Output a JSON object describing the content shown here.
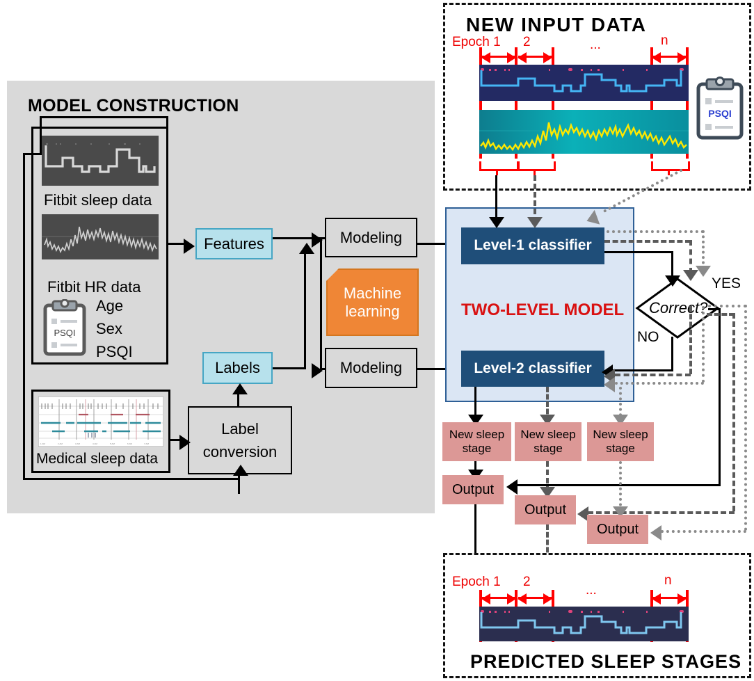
{
  "model_construction": {
    "title": "MODEL CONSTRUCTION",
    "sources": {
      "fitbit_sleep_label": "Fitbit sleep data",
      "fitbit_hr_label": "Fitbit HR data",
      "demographics": [
        "Age",
        "Sex",
        "PSQI"
      ],
      "clipboard_text": "PSQI",
      "medical_label": "Medical sleep data"
    },
    "features_label": "Features",
    "labels_label": "Labels",
    "label_conversion": "Label\nconversion",
    "label_conversion_line1": "Label",
    "label_conversion_line2": "conversion",
    "modeling_top": "Modeling",
    "modeling_bottom": "Modeling",
    "machine_learning_line1": "Machine",
    "machine_learning_line2": "learning"
  },
  "new_input": {
    "title": "NEW  INPUT  DATA",
    "epoch_first": "Epoch 1",
    "epoch_second": "2",
    "epoch_ellipsis": "...",
    "epoch_last": "n",
    "clipboard_text": "PSQI"
  },
  "two_level_model": {
    "title": "TWO-LEVEL MODEL",
    "level1": "Level-1  classifier",
    "level2": "Level-2 classifier",
    "decision": "Correct?",
    "yes": "YES",
    "no": "NO"
  },
  "outputs": {
    "new_sleep_stage": "New sleep\nstage",
    "new_sleep_stage_line1": "New sleep",
    "new_sleep_stage_line2": "stage",
    "output_label": "Output",
    "stages": [
      {
        "stage_line1": "New sleep",
        "stage_line2": "stage",
        "output": "Output"
      },
      {
        "stage_line1": "New sleep",
        "stage_line2": "stage",
        "output": "Output"
      },
      {
        "stage_line1": "New sleep",
        "stage_line2": "stage",
        "output": "Output"
      }
    ]
  },
  "predicted": {
    "title": "PREDICTED  SLEEP  STAGES",
    "epoch_first": "Epoch 1",
    "epoch_second": "2",
    "epoch_ellipsis": "...",
    "epoch_last": "n"
  },
  "colors": {
    "panel_gray": "#d9d9d9",
    "navy": "#1f4e79",
    "light_blue_panel": "#dbe6f4",
    "cyan_box": "#b7e1ec",
    "orange": "#ef8636",
    "pink": "#dc9896",
    "red_accent": "#ee0000",
    "title_red": "#d91111"
  }
}
